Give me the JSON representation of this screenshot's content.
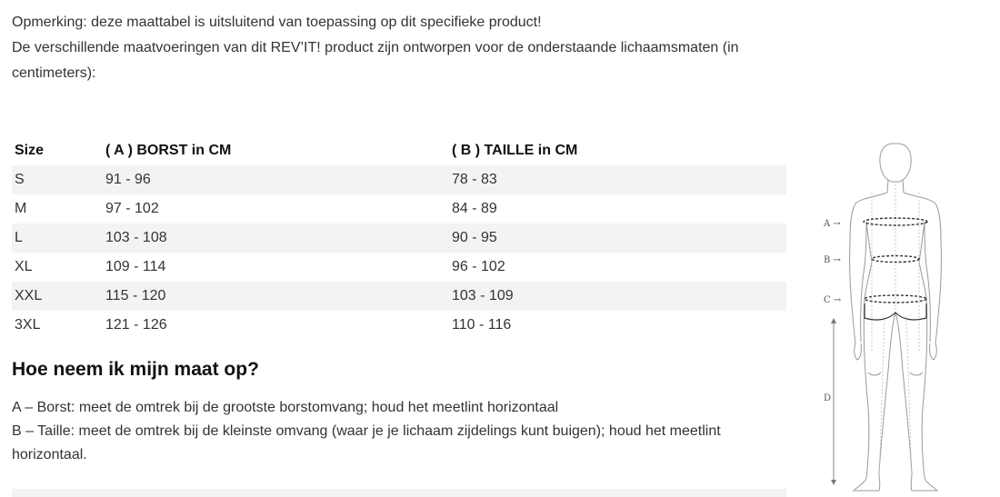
{
  "intro": {
    "line1": "Opmerking: deze maattabel is uitsluitend van toepassing op dit specifieke product!",
    "line2": "De verschillende maatvoeringen van dit REV’IT! product zijn ontworpen voor de onderstaande lichaamsmaten (in centimeters):"
  },
  "table": {
    "headers": {
      "size": "Size",
      "a": "( A ) BORST in CM",
      "b": "( B ) TAILLE in CM"
    },
    "rows": [
      {
        "size": "S",
        "a": "91 - 96",
        "b": "78 - 83"
      },
      {
        "size": "M",
        "a": "97 - 102",
        "b": "84 - 89"
      },
      {
        "size": "L",
        "a": "103 - 108",
        "b": "90 - 95"
      },
      {
        "size": "XL",
        "a": "109 - 114",
        "b": "96 - 102"
      },
      {
        "size": "XXL",
        "a": "115 - 120",
        "b": "103 - 109"
      },
      {
        "size": "3XL",
        "a": "121 - 126",
        "b": "110 - 116"
      }
    ]
  },
  "howto": {
    "title": "Hoe neem ik mijn maat op?",
    "a": "A – Borst: meet de omtrek bij de grootste borstomvang; houd het meetlint horizontaal",
    "b": "B – Taille: meet de omtrek bij de kleinste omvang (waar je je lichaam zijdelings kunt buigen); houd het meetlint horizontaal."
  },
  "figure": {
    "labels": {
      "a": "A →",
      "b": "B →",
      "c": "C →",
      "d": "D"
    },
    "icon": "body-measurement-figure"
  }
}
